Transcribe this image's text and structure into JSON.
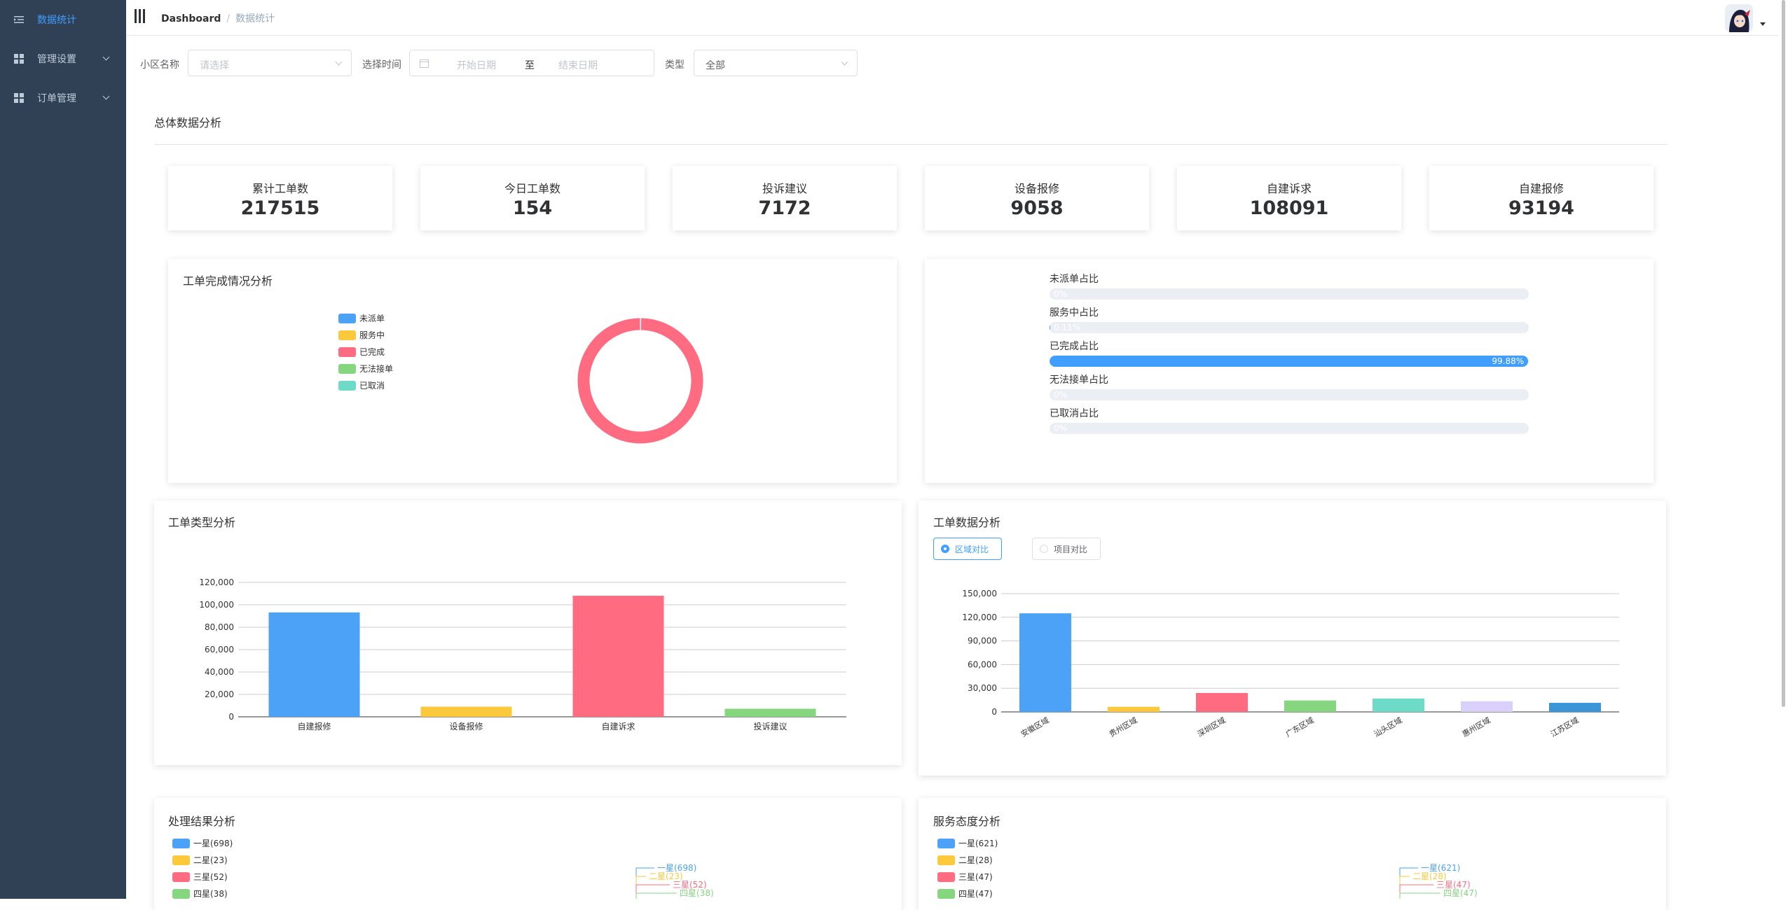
{
  "sidebar": {
    "items": [
      {
        "label": "数据统计",
        "active": true
      },
      {
        "label": "管理设置",
        "active": false
      },
      {
        "label": "订单管理",
        "active": false
      }
    ]
  },
  "breadcrumb": {
    "home": "Dashboard",
    "current": "数据统计"
  },
  "filters": {
    "community_label": "小区名称",
    "community_placeholder": "请选择",
    "time_label": "选择时间",
    "start_placeholder": "开始日期",
    "range_sep": "至",
    "end_placeholder": "结束日期",
    "type_label": "类型",
    "type_value": "全部"
  },
  "overview": {
    "title": "总体数据分析",
    "stats": [
      {
        "label": "累计工单数",
        "value": "217515"
      },
      {
        "label": "今日工单数",
        "value": "154"
      },
      {
        "label": "投诉建议",
        "value": "7172"
      },
      {
        "label": "设备报修",
        "value": "9058"
      },
      {
        "label": "自建诉求",
        "value": "108091"
      },
      {
        "label": "自建报修",
        "value": "93194"
      }
    ]
  },
  "completion": {
    "title": "工单完成情况分析",
    "legend": [
      {
        "label": "未派单",
        "color": "#4ba2f6"
      },
      {
        "label": "服务中",
        "color": "#fbc93b"
      },
      {
        "label": "已完成",
        "color": "#ff6b81"
      },
      {
        "label": "无法接单",
        "color": "#85d67f"
      },
      {
        "label": "已取消",
        "color": "#6edbc9"
      }
    ]
  },
  "ratios": [
    {
      "label": "未派单占比",
      "percent": 0,
      "text": "0%"
    },
    {
      "label": "服务中占比",
      "percent": 0.11,
      "text": "0.11%"
    },
    {
      "label": "已完成占比",
      "percent": 99.88,
      "text": "99.88%"
    },
    {
      "label": "无法接单占比",
      "percent": 0,
      "text": "0%"
    },
    {
      "label": "已取消占比",
      "percent": 0,
      "text": "0%"
    }
  ],
  "type_panel": {
    "title": "工单类型分析"
  },
  "data_panel": {
    "title": "工单数据分析",
    "radio_region": "区域对比",
    "radio_project": "项目对比"
  },
  "result_panel": {
    "title": "处理结果分析"
  },
  "attitude_panel": {
    "title": "服务态度分析"
  },
  "chart_data": [
    {
      "type": "pie",
      "title": "工单完成情况分析",
      "categories": [
        "未派单",
        "服务中",
        "已完成",
        "无法接单",
        "已取消"
      ],
      "values": [
        0,
        0.11,
        99.88,
        0,
        0
      ],
      "colors": [
        "#4ba2f6",
        "#fbc93b",
        "#ff6b81",
        "#85d67f",
        "#6edbc9"
      ]
    },
    {
      "type": "bar",
      "title": "工单类型分析",
      "categories": [
        "自建报修",
        "设备报修",
        "自建诉求",
        "投诉建议"
      ],
      "values": [
        93194,
        9058,
        108091,
        7172
      ],
      "colors": [
        "#4ba2f6",
        "#fbc93b",
        "#ff6b81",
        "#85d67f"
      ],
      "ylim": [
        0,
        120000
      ],
      "yticks": [
        0,
        20000,
        40000,
        60000,
        80000,
        100000,
        120000
      ],
      "ytick_labels": [
        "0",
        "20,000",
        "40,000",
        "60,000",
        "80,000",
        "100,000",
        "120,000"
      ],
      "grid": true
    },
    {
      "type": "bar",
      "title": "工单数据分析",
      "categories": [
        "安徽区域",
        "贵州区域",
        "深圳区域",
        "广东区域",
        "汕头区域",
        "惠州区域",
        "江苏区域"
      ],
      "values": [
        125000,
        6500,
        24000,
        14500,
        17000,
        13500,
        11500
      ],
      "colors": [
        "#4ba2f6",
        "#fbc93b",
        "#ff6b81",
        "#85d67f",
        "#6edbc9",
        "#d9d0fb",
        "#3a96d8"
      ],
      "ylim": [
        0,
        150000
      ],
      "yticks": [
        0,
        30000,
        60000,
        90000,
        120000,
        150000
      ],
      "ytick_labels": [
        "0",
        "30,000",
        "60,000",
        "90,000",
        "120,000",
        "150,000"
      ],
      "grid": true
    },
    {
      "type": "pie",
      "title": "处理结果分析",
      "categories": [
        "一星(698)",
        "二星(23)",
        "三星(52)",
        "四星(38)"
      ],
      "values": [
        698,
        23,
        52,
        38
      ],
      "colors": [
        "#4ba2f6",
        "#fbc93b",
        "#ff6b81",
        "#85d67f"
      ]
    },
    {
      "type": "pie",
      "title": "服务态度分析",
      "categories": [
        "一星(621)",
        "二星(28)",
        "三星(47)",
        "四星(47)"
      ],
      "values": [
        621,
        28,
        47,
        47
      ],
      "colors": [
        "#4ba2f6",
        "#fbc93b",
        "#ff6b81",
        "#85d67f"
      ]
    }
  ]
}
